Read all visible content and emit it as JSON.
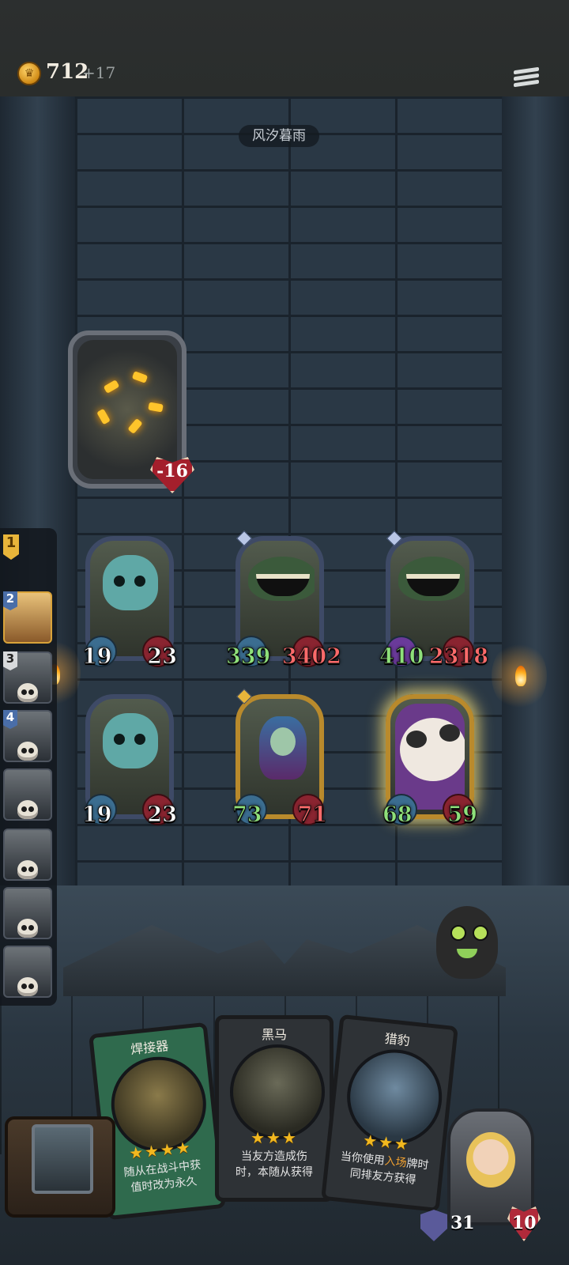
{
  "header": {
    "gold": "712",
    "gold_increment": "+17",
    "coin_icon": "crown-coin-icon",
    "menu_icon": "hamburger-menu-icon"
  },
  "arena": {
    "zone_title": "风汐暮雨"
  },
  "enemy": {
    "damage_taken": "-16"
  },
  "turn_order": {
    "current_round": "1",
    "slots": [
      {
        "number": "2",
        "state": "active"
      },
      {
        "number": "3",
        "state": "defeated"
      },
      {
        "number": "4",
        "state": "defeated"
      },
      {
        "number": "",
        "state": "defeated"
      },
      {
        "number": "",
        "state": "defeated"
      },
      {
        "number": "",
        "state": "defeated"
      },
      {
        "number": "",
        "state": "defeated"
      }
    ]
  },
  "board": {
    "row1": [
      {
        "name": "gargoyle",
        "attack": "19",
        "health": "23"
      },
      {
        "name": "maw-beast-1",
        "attack": "339",
        "health": "3402"
      },
      {
        "name": "maw-beast-2",
        "attack": "410",
        "health": "2318"
      }
    ],
    "row2": [
      {
        "name": "gargoyle",
        "attack": "19",
        "health": "23"
      },
      {
        "name": "elf-sorceress",
        "attack": "73",
        "health": "71"
      },
      {
        "name": "cow-creature",
        "attack": "68",
        "health": "59"
      }
    ]
  },
  "hand": [
    {
      "title": "焊接器",
      "stars": "★★★★",
      "text_line1": "随从在战斗中获",
      "text_line2": "值时改为永久"
    },
    {
      "title": "黑马",
      "stars": "★★★",
      "text_line1": "当友方造成伤",
      "text_line2": "时，本随从获得"
    },
    {
      "title": "猎豹",
      "stars": "★★★",
      "text_pre": "当你使用",
      "text_keyword": "入场",
      "text_post": "牌时",
      "text_line2": "同排友方获得"
    }
  ],
  "player": {
    "armor": "31",
    "health": "10"
  },
  "colors": {
    "accent_gold": "#e8b53a",
    "health_red": "#b02a3a",
    "stat_green": "#8ee07a",
    "stat_red": "#ff6a6a"
  }
}
